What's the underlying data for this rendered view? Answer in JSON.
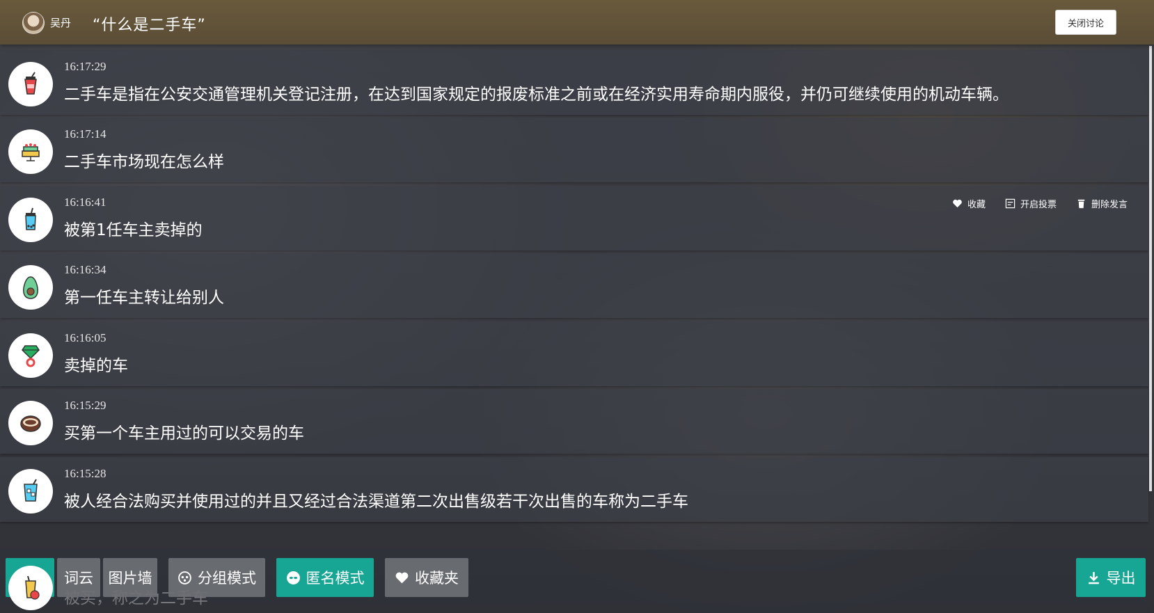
{
  "header": {
    "user_name": "吴丹",
    "topic_title": "“什么是二手车”",
    "close_button": "关闭讨论"
  },
  "messages": [
    {
      "time": "16:17:29",
      "text": "二手车是指在公安交通管理机关登记注册，在达到国家规定的报废标准之前或在经济实用寿命期内服役，并仍可继续使用的机动车辆。",
      "avatar_icon": "drink-cup-icon"
    },
    {
      "time": "16:17:14",
      "text": "二手车市场现在怎么样",
      "avatar_icon": "cake-icon"
    },
    {
      "time": "16:16:41",
      "text": "被第1任车主卖掉的",
      "avatar_icon": "milk-tea-icon"
    },
    {
      "time": "16:16:34",
      "text": "第一任车主转让给别人",
      "avatar_icon": "avocado-icon"
    },
    {
      "time": "16:16:05",
      "text": "卖掉的车",
      "avatar_icon": "gem-ring-icon"
    },
    {
      "time": "16:15:29",
      "text": "买第一个车主用过的可以交易的车",
      "avatar_icon": "cookie-icon"
    },
    {
      "time": "16:15:28",
      "text": "被人经合法购买并使用过的并且又经过合法渠道第二次出售级若干次出售的车称为二手车",
      "avatar_icon": "iced-drink-icon"
    }
  ],
  "partial_message": {
    "text": "被买，称之为二手车",
    "avatar_icon": "fruit-juice-icon"
  },
  "message_actions": {
    "favorite": "收藏",
    "open_vote": "开启投票",
    "delete": "删除发言"
  },
  "toolbar": {
    "word_cloud": "词云",
    "image_wall": "图片墙",
    "group_mode": "分组模式",
    "anonymous_mode": "匿名模式",
    "favorites": "收藏夹",
    "export": "导出"
  },
  "colors": {
    "header_bg": "#5f513a",
    "teal": "#17a594",
    "grey_button": "#6e7075"
  }
}
